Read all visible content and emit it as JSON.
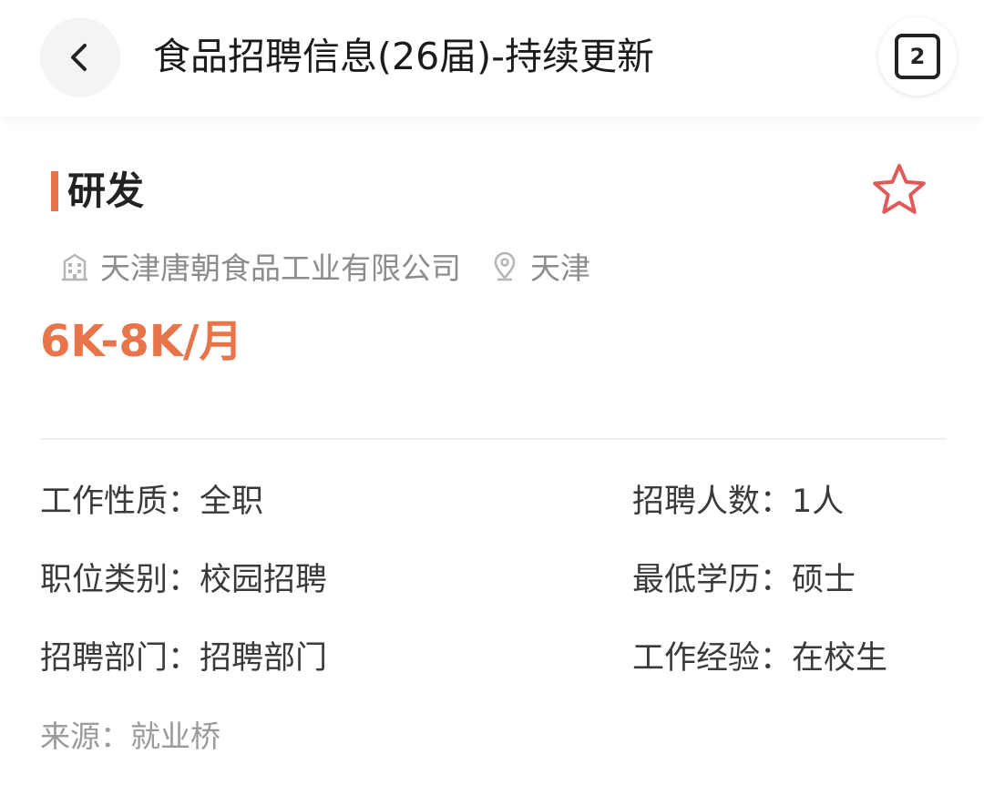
{
  "header": {
    "title": "食品招聘信息(26届)-持续更新",
    "tabs_count": "2",
    "back_icon": "chevron-left-icon",
    "tabs_icon": "tab-switcher-icon"
  },
  "job": {
    "title": "研发",
    "company": "天津唐朝食品工业有限公司",
    "location": "天津",
    "salary": "6K-8K/月",
    "favorite_icon": "star-outline-icon",
    "company_icon": "building-icon",
    "location_icon": "location-pin-icon"
  },
  "details": {
    "left": [
      {
        "label": "工作性质：",
        "value": "全职"
      },
      {
        "label": "职位类别：",
        "value": "校园招聘"
      },
      {
        "label": "招聘部门：",
        "value": "招聘部门"
      }
    ],
    "right": [
      {
        "label": "招聘人数：",
        "value": "1人"
      },
      {
        "label": "最低学历：",
        "value": "硕士"
      },
      {
        "label": "工作经验：",
        "value": "在校生"
      }
    ]
  },
  "source": {
    "label": "来源：",
    "value": "就业桥"
  },
  "colors": {
    "accent": "#e8744a",
    "star": "#e05a5a",
    "muted_text": "#8c8c8c",
    "body_text": "#3a3a3a"
  }
}
